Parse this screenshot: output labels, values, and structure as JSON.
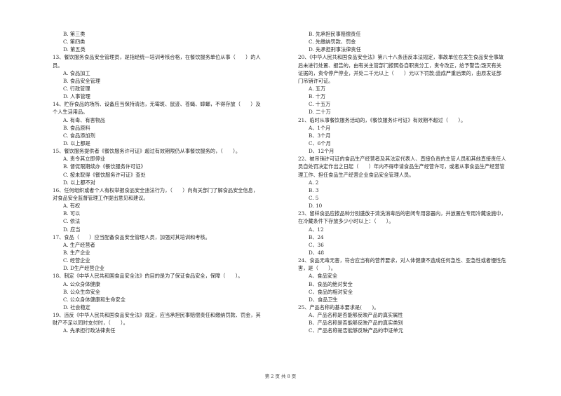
{
  "page": {
    "footer": "第 2 页 共 8 页"
  },
  "left_column": [
    {
      "type": "opt",
      "text": "B. 第三类"
    },
    {
      "type": "opt",
      "text": "C. 第四类"
    },
    {
      "type": "opt",
      "text": "D. 第五类"
    },
    {
      "type": "q",
      "text": "13、餐饮服务食品安全管理员，是指经统一培训考核合格，在餐饮服务单位从事（　　）的人"
    },
    {
      "type": "qcont",
      "text": "员。"
    },
    {
      "type": "opt",
      "text": "A. 食品加工"
    },
    {
      "type": "opt",
      "text": "B. 食品安全管理"
    },
    {
      "type": "opt",
      "text": "C. 行政管理"
    },
    {
      "type": "opt",
      "text": "D. 人事管理"
    },
    {
      "type": "q",
      "text": "14、贮存食品的场所、设备应当保持清洁，无霉斑、鼠迹、苍蝇、蟑螂，不得存放（　　）及"
    },
    {
      "type": "qcont",
      "text": "个人生活用品。"
    },
    {
      "type": "opt",
      "text": "A. 有毒、有害物品"
    },
    {
      "type": "opt",
      "text": "B. 食品原料"
    },
    {
      "type": "opt",
      "text": "C. 食品添加剂"
    },
    {
      "type": "opt",
      "text": "D. 以上都是"
    },
    {
      "type": "q",
      "text": "15、餐饮服务提供者《餐饮服务许可证》超过有效期限仍从事餐饮服务的，（　　）。"
    },
    {
      "type": "opt",
      "text": "A. 责令其立即停业"
    },
    {
      "type": "opt",
      "text": "B. 督促限期续办《餐饮服务许可证》"
    },
    {
      "type": "opt",
      "text": "C. 按未取得《餐饮服务许可证》查处"
    },
    {
      "type": "opt",
      "text": "D. 以上都不对"
    },
    {
      "type": "q",
      "text": "16、任何组织或者个人有权举报食品安全违法行为，（　　）向有关部门了解食品安全信息，"
    },
    {
      "type": "qcont",
      "text": "对食品安全监督管理工作提出意见和建议。"
    },
    {
      "type": "opt",
      "text": "A. 有权"
    },
    {
      "type": "opt",
      "text": "B. 可以"
    },
    {
      "type": "opt",
      "text": "C. 依法"
    },
    {
      "type": "opt",
      "text": "D. 应当"
    },
    {
      "type": "q",
      "text": "17、食品（　　）应当配备食品安全管理人员，加强对其培训和考核。"
    },
    {
      "type": "opt",
      "text": "A. 生产经营者"
    },
    {
      "type": "opt",
      "text": "B. 生产企业"
    },
    {
      "type": "opt",
      "text": "C. 经营企业"
    },
    {
      "type": "opt",
      "text": "D. D生产经营企业"
    },
    {
      "type": "q",
      "text": "18、制定《中华人民共和国食品安全法》的目的是为了保证食品安全，保障（　　）。"
    },
    {
      "type": "opt",
      "text": "A. 公众身体健康"
    },
    {
      "type": "opt",
      "text": "B. 公众生命安全"
    },
    {
      "type": "opt",
      "text": "C. 公众身体健康和生命安全"
    },
    {
      "type": "opt",
      "text": "D. 社会稳定"
    },
    {
      "type": "q",
      "text": "19、违反《中华人民共和国食品安全法》规定，应当承担民事赔偿责任和缴纳罚款、罚金，其"
    },
    {
      "type": "qcont",
      "text": "财产不足以同时支付时，（　　）。"
    },
    {
      "type": "opt",
      "text": "A. 先承担行政法律责任"
    }
  ],
  "right_column": [
    {
      "type": "opt",
      "text": "B. 先承担民事赔偿责任"
    },
    {
      "type": "opt",
      "text": "C. 先缴纳罚款、罚金"
    },
    {
      "type": "opt",
      "text": "D. 先承担刑事法律责任"
    },
    {
      "type": "q",
      "text": "20、《中华人民共和国食品安全法》第八十八条违反本法规定，事故单位在发生食品安全事故"
    },
    {
      "type": "qcont",
      "text": "后未进行处置、报告的，由有关主管部门按照各自职责分工，责令改正，给予警告;毁灭有关"
    },
    {
      "type": "qcont",
      "text": "证据的，责令停产停业，并处二千元以上（　　）元以下罚款;造成严重后果的，由原发证部"
    },
    {
      "type": "qcont",
      "text": "门吊销许可证。"
    },
    {
      "type": "opt",
      "text": "A. 五万"
    },
    {
      "type": "opt",
      "text": "B. 十万"
    },
    {
      "type": "opt",
      "text": "C. 十五万"
    },
    {
      "type": "opt",
      "text": "D. 二十万"
    },
    {
      "type": "q",
      "text": "21、临时从事餐饮服务活动的，《餐饮服务许可证》有效期不超过（　　）。"
    },
    {
      "type": "opt",
      "text": "A、1个月"
    },
    {
      "type": "opt",
      "text": "B、3个月"
    },
    {
      "type": "opt",
      "text": "C、6个月"
    },
    {
      "type": "opt",
      "text": "D、12个月"
    },
    {
      "type": "q",
      "text": "22、被吊销许可证的食品生产经营者及其法定代表人、直接负责的主管人员和其他直接责任人"
    },
    {
      "type": "qcont",
      "text": "员自处罚决定作出之日起（　　）年内不得申请食品生产经营许可，或者从事食品生产经营管"
    },
    {
      "type": "qcont",
      "text": "理工作、担任食品生产经营企业食品安全管理人员。"
    },
    {
      "type": "opt",
      "text": "A. 2"
    },
    {
      "type": "opt",
      "text": "B. 3"
    },
    {
      "type": "opt",
      "text": "C. 5"
    },
    {
      "type": "opt",
      "text": "D. 10"
    },
    {
      "type": "q",
      "text": "23、留样食品应按品种分别盛放于清洗消毒后的密闭专用容器内，并放置在专用冷藏设施中，"
    },
    {
      "type": "qcont",
      "text": "在冷藏条件下存放多少小时以上：（　　）。"
    },
    {
      "type": "opt",
      "text": "A、12"
    },
    {
      "type": "opt",
      "text": "B、24"
    },
    {
      "type": "opt",
      "text": "C、36"
    },
    {
      "type": "opt",
      "text": "D、48"
    },
    {
      "type": "q",
      "text": "24、食品无毒无害，符合应当有的营养要求，对人体健康不造成任何急性、亚急性或者慢性危"
    },
    {
      "type": "qcont",
      "text": "害，是（　　）。"
    },
    {
      "type": "opt",
      "text": "A、食品安全"
    },
    {
      "type": "opt",
      "text": "B、食品的绝对安全"
    },
    {
      "type": "opt",
      "text": "C、食品的相对安全"
    },
    {
      "type": "opt",
      "text": "D、食品卫生"
    },
    {
      "type": "q",
      "text": "25、产品名称的基本要求是(　　)。"
    },
    {
      "type": "opt",
      "text": "A、产品名称是否能够反映产品的真实属性"
    },
    {
      "type": "opt",
      "text": "B、产品名称是否能够反映产品的真实类别"
    },
    {
      "type": "opt",
      "text": "C、产品名称是否能够反映产品的申证单元"
    }
  ]
}
